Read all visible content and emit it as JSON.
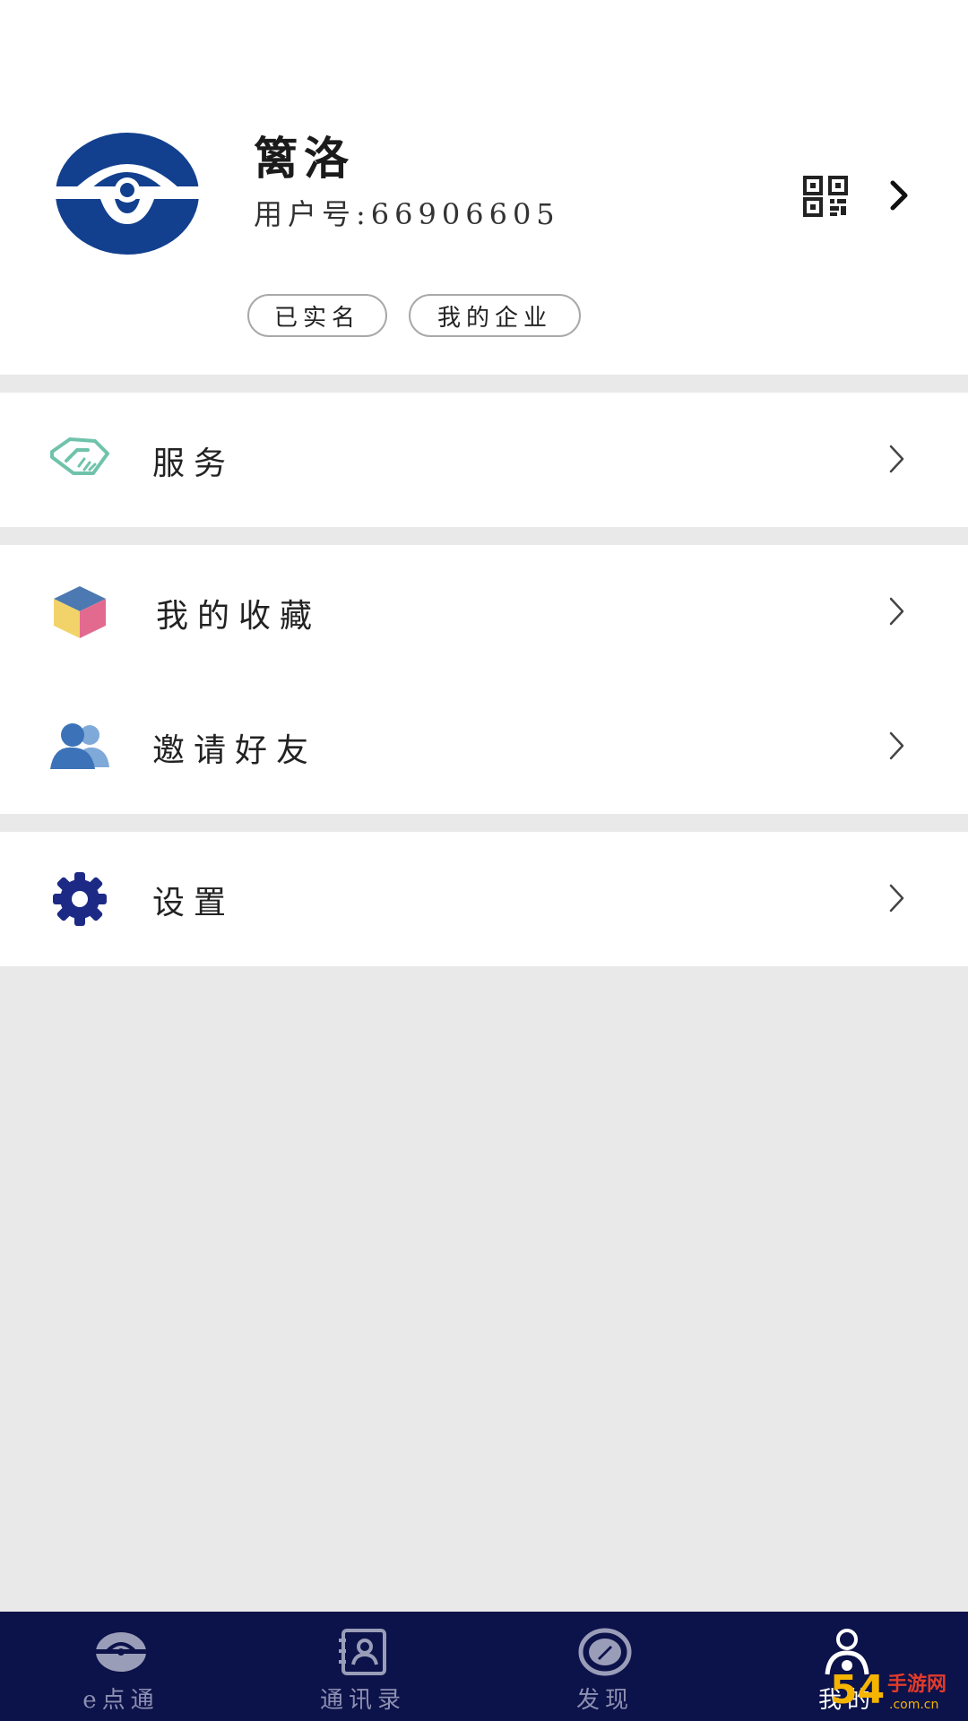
{
  "profile": {
    "name": "篱洛",
    "user_id": "用户号:66906605",
    "tags": {
      "verified": "已实名",
      "company": "我的企业"
    },
    "avatar_icon": "app-logo-icon",
    "qr_icon": "qr-code-icon"
  },
  "menu": {
    "services": {
      "label": "服务",
      "icon": "handshake-icon"
    },
    "favorites": {
      "label": "我的收藏",
      "icon": "cube-icon"
    },
    "invite": {
      "label": "邀请好友",
      "icon": "users-icon"
    },
    "settings": {
      "label": "设置",
      "icon": "gear-icon"
    }
  },
  "tabbar": {
    "home": "e点通",
    "contacts": "通讯录",
    "discover": "发现",
    "me": "我的"
  },
  "watermark": {
    "brand": "54",
    "text": "手游网",
    "domain": ".com.cn"
  },
  "colors": {
    "brand_blue": "#12408e",
    "tabbar_bg": "#0c124a",
    "settings_icon": "#1c2a86"
  }
}
